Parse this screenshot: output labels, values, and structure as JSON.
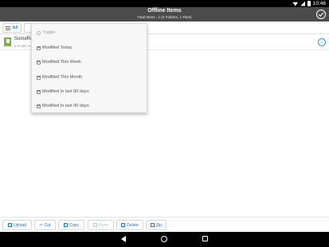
{
  "status_bar": {
    "time": "10:46"
  },
  "header": {
    "title": "Offline Items",
    "subtitle": "Total Items : 1 (0 Folders, 1 Files)",
    "check_icon": "check-circle-icon"
  },
  "filter_bar": {
    "all_label": "All"
  },
  "files": [
    {
      "name": "SomeRa",
      "meta": "0.54 MB, m",
      "icon": "file-icon"
    }
  ],
  "dropdown": {
    "items": [
      {
        "label": "Toggle",
        "icon": "circle-icon",
        "disabled": true
      },
      {
        "label": "Modified Today",
        "icon": "calendar-icon"
      },
      {
        "label": "Modified This Week",
        "icon": "calendar-icon"
      },
      {
        "label": "Modified This Month",
        "icon": "calendar-icon"
      },
      {
        "label": "Modified In last 60 days",
        "icon": "calendar-icon"
      },
      {
        "label": "Modified In last 90 days",
        "icon": "calendar-icon"
      }
    ]
  },
  "toolbar": {
    "upload": "Upload",
    "cut": "Cut",
    "copy": "Copy",
    "paste": "Paste",
    "delete": "Delete",
    "zip": "Zip"
  },
  "colors": {
    "header_bg": "#4b4b4b",
    "accent": "#1e88e5",
    "file_icon": "#7cb342"
  }
}
